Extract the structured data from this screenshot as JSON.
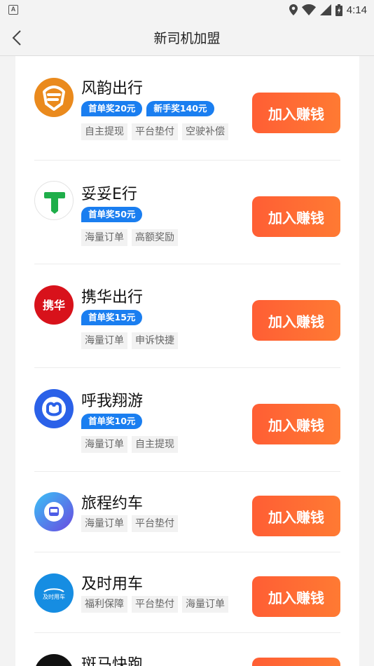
{
  "status_bar": {
    "time": "4:14",
    "notification_letter": "A"
  },
  "header": {
    "title": "新司机加盟"
  },
  "join_label": "加入赚钱",
  "items": [
    {
      "name": "风韵出行",
      "badges": [
        "首单奖20元",
        "新手奖140元"
      ],
      "tags": [
        "自主提现",
        "平台垫付",
        "空驶补偿"
      ]
    },
    {
      "name": "妥妥E行",
      "badges": [
        "首单奖50元"
      ],
      "tags": [
        "海量订单",
        "高额奖励"
      ]
    },
    {
      "name": "携华出行",
      "logo_text": "携华",
      "badges": [
        "首单奖15元"
      ],
      "tags": [
        "海量订单",
        "申诉快捷"
      ]
    },
    {
      "name": "呼我翔游",
      "badges": [
        "首单奖10元"
      ],
      "tags": [
        "海量订单",
        "自主提现"
      ]
    },
    {
      "name": "旅程约车",
      "badges": [],
      "tags": [
        "海量订单",
        "平台垫付"
      ]
    },
    {
      "name": "及时用车",
      "logo_text": "及时用车",
      "badges": [],
      "tags": [
        "福利保障",
        "平台垫付",
        "海量订单"
      ]
    },
    {
      "name": "斑马快跑",
      "badges": [],
      "tags": []
    }
  ],
  "colors": {
    "accent_blue": "#1a7ef0",
    "join_orange": "#ff6a33",
    "background": "#f3f3f3"
  }
}
